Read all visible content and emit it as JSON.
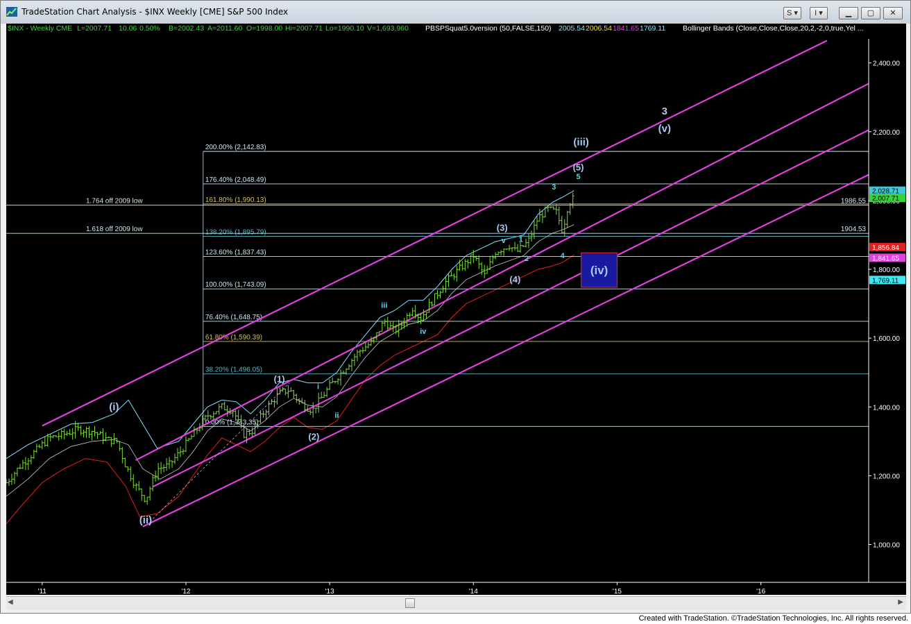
{
  "window": {
    "title": "TradeStation Chart Analysis - $INX Weekly [CME] S&P 500 Index",
    "buttons": [
      "S",
      "I"
    ]
  },
  "status_bar": {
    "symbol": "$INX - Weekly  CME",
    "last": "L=2007.71",
    "change": "10.06",
    "pct": "0.50%",
    "bid": "B=2002.43",
    "ask": "A=2011.60",
    "open": "O=1998.00",
    "high": "Hi=2007.71",
    "low": "Lo=1990.10",
    "volume": "V=1,693,960",
    "indicator": "PBSPSquat5.0version (50,FALSE,150)",
    "v1": "2005.54",
    "v2": "2006.54",
    "v3": "1841.65",
    "v4": "1769.11",
    "bb": "Bollinger Bands (Close,Close,Close,20,2,-2,0,true,Yel ..."
  },
  "footer": "Created with TradeStation. ©TradeStation Technologies, Inc. All rights reserved.",
  "colors": {
    "background": "#000000",
    "price_bars": "#7ddc3c",
    "channel": "#e040e0",
    "upper_band": "#7fe5ff",
    "lower_band": "#e81e1e",
    "middle_band": "#c8c8c8",
    "fib_lines": "#cde7f2",
    "fib_gold": "#d4c060",
    "label": "#a8c8f0"
  },
  "chart_data": {
    "type": "bar",
    "title": "$INX Weekly S&P 500 Index",
    "x_axis_labels": [
      "'11",
      "'12",
      "'13",
      "'14",
      "'15",
      "'16"
    ],
    "x_axis_start": 2010.75,
    "x_axis_end": 2016.75,
    "y_axis_ticks": [
      "1,000.00",
      "1,200.00",
      "1,400.00",
      "1,600.00",
      "1,800.00",
      "2,000.00",
      "2,200.00",
      "2,400.00"
    ],
    "y_tick_values": [
      1000,
      1200,
      1400,
      1600,
      1800,
      2000,
      2200,
      2400
    ],
    "ylim": [
      890,
      2470
    ],
    "price_tags": [
      {
        "text": "2,028.71",
        "value": 2028.71,
        "color": "#3ec8d8"
      },
      {
        "text": "2,007.71",
        "value": 2007.71,
        "color": "#39d239"
      },
      {
        "text": "1,856.84",
        "value": 1856.84,
        "color": "#e02020"
      },
      {
        "text": "1,841.65",
        "value": 1841.65,
        "color": "#e040e0"
      },
      {
        "text": "1,769.11",
        "value": 1769.11,
        "color": "#3ee8f0"
      }
    ],
    "horizontal_levels": [
      {
        "label": "1.764 off 2009 low",
        "value": 1986.55,
        "right_label": "1986.55"
      },
      {
        "label": "1.618 off 2009 low",
        "value": 1904.53,
        "right_label": "1904.53"
      }
    ],
    "fib_levels": [
      {
        "label": "200.00% (2,142.83)",
        "value": 2142.83,
        "color": "#cde7f2"
      },
      {
        "label": "176.40% (2,048.49)",
        "value": 2048.49,
        "color": "#cde7f2"
      },
      {
        "label": "161.80% (1,990.13)",
        "value": 1990.13,
        "color": "#d4c060"
      },
      {
        "label": "138.20% (1,895.79)",
        "value": 1895.79,
        "color": "#5bb8c8"
      },
      {
        "label": "123.60% (1,837.43)",
        "value": 1837.43,
        "color": "#cde7f2"
      },
      {
        "label": "100.00% (1,743.09)",
        "value": 1743.09,
        "color": "#cde7f2"
      },
      {
        "label": "76.40% (1,648.75)",
        "value": 1648.75,
        "color": "#cde7f2"
      },
      {
        "label": "61.80% (1,590.39)",
        "value": 1590.39,
        "color": "#d4c060"
      },
      {
        "label": "38.20% (1,496.05)",
        "value": 1496.05,
        "color": "#5bb8c8"
      },
      {
        "label": "0.00% (1,343.35)",
        "value": 1343.35,
        "color": "#cde7f2"
      }
    ],
    "fib_start_x": 2012.12,
    "channel_lines": [
      {
        "x1": 2011.0,
        "y1": 1345,
        "x2": 2016.46,
        "y2": 2465
      },
      {
        "x1": 2011.65,
        "y1": 1245,
        "x2": 2016.75,
        "y2": 2340
      },
      {
        "x1": 2011.77,
        "y1": 1168,
        "x2": 2016.75,
        "y2": 2205
      },
      {
        "x1": 2011.7,
        "y1": 1052,
        "x2": 2016.75,
        "y2": 2075
      }
    ],
    "wave_labels": [
      {
        "text": "(i)",
        "x": 2011.5,
        "y": 1390,
        "size": "big"
      },
      {
        "text": "(ii)",
        "x": 2011.72,
        "y": 1062,
        "size": "big"
      },
      {
        "text": "(1)",
        "x": 2012.65,
        "y": 1472,
        "size": "med"
      },
      {
        "text": "(2)",
        "x": 2012.89,
        "y": 1305,
        "size": "med"
      },
      {
        "text": "i",
        "x": 2012.92,
        "y": 1452,
        "size": "small"
      },
      {
        "text": "ii",
        "x": 2013.05,
        "y": 1368,
        "size": "small"
      },
      {
        "text": "iii",
        "x": 2013.38,
        "y": 1688,
        "size": "small"
      },
      {
        "text": "iv",
        "x": 2013.65,
        "y": 1612,
        "size": "small"
      },
      {
        "text": "(3)",
        "x": 2014.2,
        "y": 1912,
        "size": "med"
      },
      {
        "text": "v",
        "x": 2014.21,
        "y": 1877,
        "size": "small"
      },
      {
        "text": "(4)",
        "x": 2014.29,
        "y": 1762,
        "size": "med"
      },
      {
        "text": "1",
        "x": 2014.33,
        "y": 1880,
        "size": "small"
      },
      {
        "text": "2",
        "x": 2014.37,
        "y": 1824,
        "size": "small"
      },
      {
        "text": "3",
        "x": 2014.56,
        "y": 2032,
        "size": "small"
      },
      {
        "text": "4",
        "x": 2014.62,
        "y": 1832,
        "size": "small"
      },
      {
        "text": "5",
        "x": 2014.73,
        "y": 2062,
        "size": "small"
      },
      {
        "text": "(5)",
        "x": 2014.73,
        "y": 2088,
        "size": "med"
      },
      {
        "text": "(iii)",
        "x": 2014.75,
        "y": 2160,
        "size": "big"
      },
      {
        "text": "3",
        "x": 2015.33,
        "y": 2250,
        "size": "big"
      },
      {
        "text": "(v)",
        "x": 2015.33,
        "y": 2200,
        "size": "big"
      }
    ],
    "target_box": {
      "label": "(iv)",
      "x1": 2014.75,
      "x2": 2015.0,
      "y1": 1748,
      "y2": 1848
    },
    "ohlc_anchors": [
      [
        2010.75,
        1180
      ],
      [
        2010.85,
        1230
      ],
      [
        2010.95,
        1270
      ],
      [
        2011.05,
        1310
      ],
      [
        2011.15,
        1320
      ],
      [
        2011.25,
        1335
      ],
      [
        2011.35,
        1330
      ],
      [
        2011.45,
        1305
      ],
      [
        2011.52,
        1300
      ],
      [
        2011.58,
        1230
      ],
      [
        2011.65,
        1170
      ],
      [
        2011.72,
        1130
      ],
      [
        2011.8,
        1220
      ],
      [
        2011.88,
        1230
      ],
      [
        2011.96,
        1270
      ],
      [
        2012.05,
        1320
      ],
      [
        2012.15,
        1375
      ],
      [
        2012.25,
        1400
      ],
      [
        2012.33,
        1390
      ],
      [
        2012.4,
        1320
      ],
      [
        2012.46,
        1330
      ],
      [
        2012.55,
        1390
      ],
      [
        2012.65,
        1440
      ],
      [
        2012.72,
        1450
      ],
      [
        2012.8,
        1410
      ],
      [
        2012.88,
        1390
      ],
      [
        2013.0,
        1460
      ],
      [
        2013.1,
        1510
      ],
      [
        2013.2,
        1560
      ],
      [
        2013.3,
        1590
      ],
      [
        2013.38,
        1650
      ],
      [
        2013.45,
        1620
      ],
      [
        2013.5,
        1640
      ],
      [
        2013.58,
        1690
      ],
      [
        2013.63,
        1655
      ],
      [
        2013.7,
        1700
      ],
      [
        2013.8,
        1760
      ],
      [
        2013.9,
        1800
      ],
      [
        2014.0,
        1840
      ],
      [
        2014.08,
        1780
      ],
      [
        2014.15,
        1850
      ],
      [
        2014.25,
        1870
      ],
      [
        2014.3,
        1850
      ],
      [
        2014.38,
        1880
      ],
      [
        2014.45,
        1950
      ],
      [
        2014.52,
        1975
      ],
      [
        2014.58,
        1965
      ],
      [
        2014.62,
        1910
      ],
      [
        2014.66,
        1990
      ],
      [
        2014.7,
        2007.71
      ]
    ],
    "upper_band_pts": [
      [
        2010.75,
        1250
      ],
      [
        2010.9,
        1290
      ],
      [
        2011.05,
        1320
      ],
      [
        2011.2,
        1350
      ],
      [
        2011.35,
        1355
      ],
      [
        2011.5,
        1380
      ],
      [
        2011.6,
        1420
      ],
      [
        2011.7,
        1350
      ],
      [
        2011.8,
        1280
      ],
      [
        2011.95,
        1300
      ],
      [
        2012.05,
        1350
      ],
      [
        2012.15,
        1400
      ],
      [
        2012.25,
        1420
      ],
      [
        2012.35,
        1415
      ],
      [
        2012.45,
        1380
      ],
      [
        2012.55,
        1420
      ],
      [
        2012.65,
        1470
      ],
      [
        2012.75,
        1480
      ],
      [
        2012.85,
        1470
      ],
      [
        2012.95,
        1470
      ],
      [
        2013.05,
        1500
      ],
      [
        2013.15,
        1560
      ],
      [
        2013.25,
        1610
      ],
      [
        2013.35,
        1660
      ],
      [
        2013.45,
        1680
      ],
      [
        2013.55,
        1710
      ],
      [
        2013.65,
        1710
      ],
      [
        2013.75,
        1750
      ],
      [
        2013.85,
        1800
      ],
      [
        2013.95,
        1840
      ],
      [
        2014.05,
        1860
      ],
      [
        2014.15,
        1880
      ],
      [
        2014.25,
        1890
      ],
      [
        2014.35,
        1900
      ],
      [
        2014.45,
        1960
      ],
      [
        2014.55,
        1995
      ],
      [
        2014.62,
        2010
      ],
      [
        2014.7,
        2028.71
      ]
    ],
    "lower_band_pts": [
      [
        2010.75,
        1060
      ],
      [
        2010.85,
        1110
      ],
      [
        2011.0,
        1180
      ],
      [
        2011.15,
        1220
      ],
      [
        2011.3,
        1250
      ],
      [
        2011.45,
        1240
      ],
      [
        2011.58,
        1170
      ],
      [
        2011.68,
        1080
      ],
      [
        2011.8,
        1090
      ],
      [
        2011.95,
        1140
      ],
      [
        2012.05,
        1200
      ],
      [
        2012.15,
        1260
      ],
      [
        2012.25,
        1310
      ],
      [
        2012.35,
        1290
      ],
      [
        2012.45,
        1270
      ],
      [
        2012.55,
        1300
      ],
      [
        2012.65,
        1340
      ],
      [
        2012.75,
        1370
      ],
      [
        2012.85,
        1340
      ],
      [
        2012.95,
        1335
      ],
      [
        2013.05,
        1360
      ],
      [
        2013.15,
        1420
      ],
      [
        2013.25,
        1480
      ],
      [
        2013.35,
        1520
      ],
      [
        2013.45,
        1550
      ],
      [
        2013.55,
        1570
      ],
      [
        2013.65,
        1590
      ],
      [
        2013.75,
        1610
      ],
      [
        2013.85,
        1660
      ],
      [
        2013.95,
        1700
      ],
      [
        2014.05,
        1720
      ],
      [
        2014.15,
        1740
      ],
      [
        2014.25,
        1760
      ],
      [
        2014.35,
        1780
      ],
      [
        2014.45,
        1800
      ],
      [
        2014.55,
        1810
      ],
      [
        2014.62,
        1820
      ],
      [
        2014.7,
        1841.65
      ]
    ],
    "middle_band_pts": [
      [
        2010.75,
        1140
      ],
      [
        2010.9,
        1190
      ],
      [
        2011.05,
        1250
      ],
      [
        2011.2,
        1285
      ],
      [
        2011.35,
        1300
      ],
      [
        2011.5,
        1305
      ],
      [
        2011.6,
        1290
      ],
      [
        2011.7,
        1220
      ],
      [
        2011.82,
        1190
      ],
      [
        2011.95,
        1220
      ],
      [
        2012.05,
        1270
      ],
      [
        2012.15,
        1330
      ],
      [
        2012.25,
        1365
      ],
      [
        2012.35,
        1355
      ],
      [
        2012.45,
        1330
      ],
      [
        2012.55,
        1360
      ],
      [
        2012.65,
        1400
      ],
      [
        2012.75,
        1425
      ],
      [
        2012.85,
        1405
      ],
      [
        2012.95,
        1400
      ],
      [
        2013.05,
        1430
      ],
      [
        2013.15,
        1490
      ],
      [
        2013.25,
        1545
      ],
      [
        2013.35,
        1590
      ],
      [
        2013.45,
        1615
      ],
      [
        2013.55,
        1640
      ],
      [
        2013.65,
        1650
      ],
      [
        2013.75,
        1680
      ],
      [
        2013.85,
        1730
      ],
      [
        2013.95,
        1770
      ],
      [
        2014.05,
        1790
      ],
      [
        2014.15,
        1810
      ],
      [
        2014.25,
        1825
      ],
      [
        2014.35,
        1840
      ],
      [
        2014.45,
        1880
      ],
      [
        2014.55,
        1905
      ],
      [
        2014.62,
        1915
      ],
      [
        2014.7,
        1930
      ]
    ],
    "dashed_wave_line": [
      [
        2011.77,
        1075
      ],
      [
        2012.72,
        1470
      ]
    ],
    "grid": false,
    "legend": "top-left"
  }
}
